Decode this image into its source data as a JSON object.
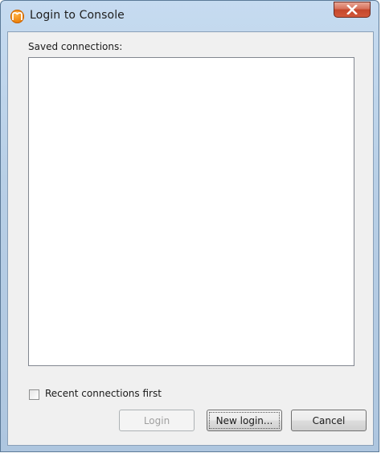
{
  "window": {
    "title": "Login to Console",
    "app_icon": "app-logo-icon",
    "close_icon": "close-icon"
  },
  "connections": {
    "label": "Saved connections:",
    "items": []
  },
  "options": {
    "recent_first_label": "Recent connections first",
    "recent_first_checked": false
  },
  "buttons": {
    "login_label": "Login",
    "new_login_label": "New login...",
    "cancel_label": "Cancel"
  },
  "colors": {
    "close_button": "#c4462b",
    "app_icon": "#f08a14"
  }
}
